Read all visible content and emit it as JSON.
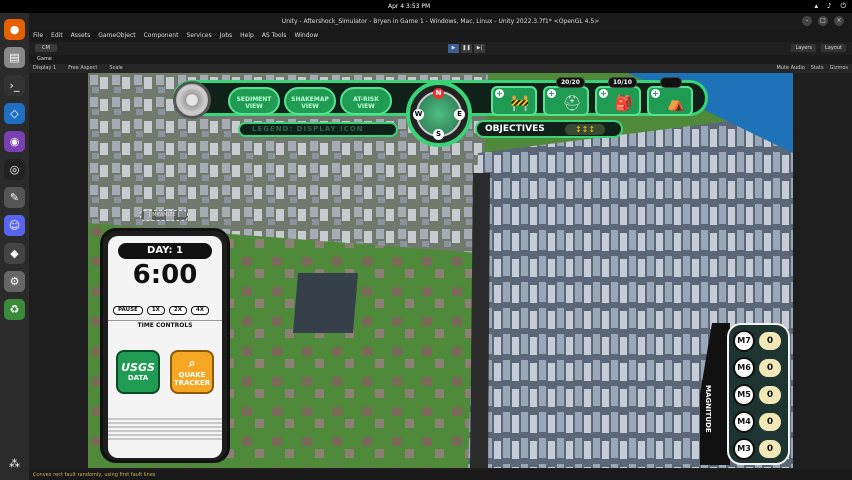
{
  "os": {
    "clock": "Apr 4  3:53 PM"
  },
  "unity": {
    "title": "Unity - Aftershock_Simulator - Bryen in Game 1 - Windows, Mac, Linux - Unity 2022.3.7f1* <OpenGL 4.5>",
    "menu": [
      "File",
      "Edit",
      "Assets",
      "GameObject",
      "Component",
      "Services",
      "Jobs",
      "Help",
      "AS Tools",
      "Window"
    ],
    "account": "CM",
    "layers": "Layers",
    "layout": "Layout",
    "scene_tab": "Game",
    "game_toolbar": {
      "display": "Display 1",
      "aspect": "Free Aspect",
      "scale": "Scale",
      "mute": "Mute Audio",
      "stats": "Stats",
      "gizmos": "Gizmos"
    },
    "status": "Convex rect fault randomly, using first fault lines"
  },
  "hud": {
    "view_buttons": [
      {
        "line1": "SEDIMENT",
        "line2": "VIEW"
      },
      {
        "line1": "SHAKEMAP",
        "line2": "VIEW"
      },
      {
        "line1": "AT-RISK",
        "line2": "VIEW"
      }
    ],
    "legend": "LEGEND: DISPLAY ICON",
    "compass": {
      "n": "N",
      "s": "S",
      "w": "W",
      "e": "E"
    },
    "objectives_label": "OBJECTIVES",
    "resource_counts": [
      "20/20",
      "10/10"
    ],
    "minimize": "[ MINIMIZE ]",
    "phone": {
      "day": "DAY: 1",
      "time": "6:00",
      "buttons": [
        "PAUSE",
        "1X",
        "2X",
        "4X"
      ],
      "time_controls": "TIME CONTROLS",
      "usgs": {
        "line1": "USGS",
        "line2": "DATA"
      },
      "quake": {
        "line1": "QUAKE",
        "line2": "TRACKER"
      }
    },
    "magnitude": {
      "title": "MAGNITUDE",
      "rows": [
        {
          "label": "M7",
          "value": "0"
        },
        {
          "label": "M6",
          "value": "0"
        },
        {
          "label": "M5",
          "value": "0"
        },
        {
          "label": "M4",
          "value": "0"
        },
        {
          "label": "M3",
          "value": "0"
        }
      ]
    }
  },
  "colors": {
    "hud_green": "#3ad478",
    "dark": "#10211a",
    "usgs": "#1f9b54",
    "quake": "#f5a623"
  }
}
